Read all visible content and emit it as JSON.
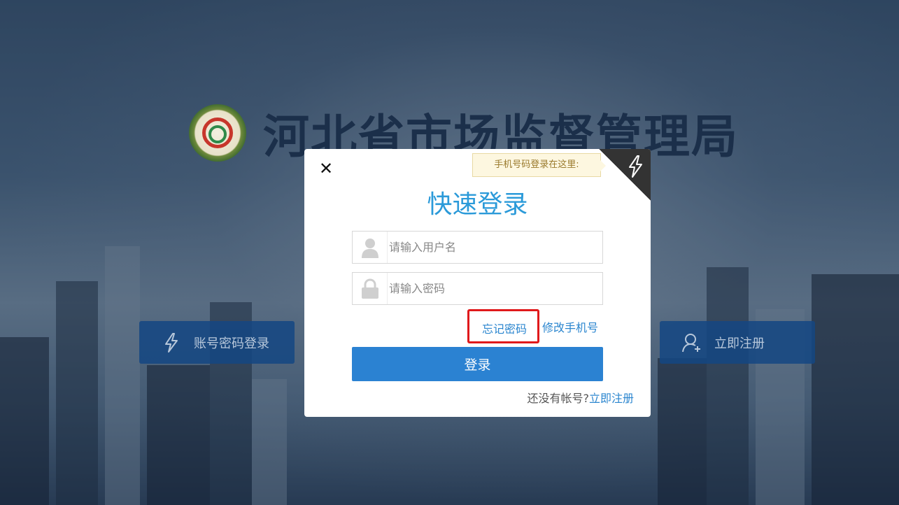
{
  "header": {
    "site_title": "河北省市场监督管理局"
  },
  "side_buttons": {
    "account_login_label": "账号密码登录",
    "register_label": "立即注册"
  },
  "modal": {
    "close_glyph": "✕",
    "phone_tip": "手机号码登录在这里:",
    "title": "快速登录",
    "username_placeholder": "请输入用户名",
    "password_placeholder": "请输入密码",
    "forgot_password": "忘记密码",
    "change_phone": "修改手机号",
    "login_button": "登录",
    "no_account_text": "还没有帐号?",
    "register_link": "立即注册"
  },
  "colors": {
    "accent": "#2b82d2",
    "title_blue": "#2b9ad9",
    "highlight_red": "#e0191b"
  },
  "icons": [
    "emblem-logo",
    "lightning-icon",
    "user-add-icon",
    "user-icon",
    "lock-icon",
    "close-icon"
  ]
}
